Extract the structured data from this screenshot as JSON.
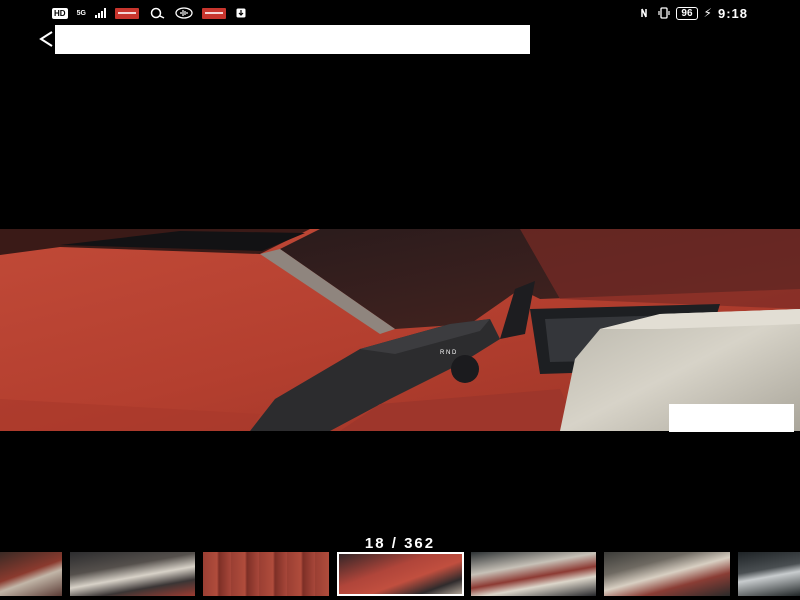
{
  "status_bar": {
    "hd": "HD",
    "network": "5G",
    "battery": "96",
    "time": "9:18",
    "icons": [
      "hd-icon",
      "signal-icon",
      "app-notification-icon",
      "message-icon",
      "radio-icon",
      "app-notification-icon",
      "download-icon",
      "nfc-icon",
      "vibrate-icon",
      "battery-icon",
      "charging-icon"
    ]
  },
  "header": {
    "back_icon": "back-arrow-icon",
    "title": ""
  },
  "viewer": {
    "counter": "18 / 362",
    "current_index": 18,
    "total": 362,
    "selected_thumbnail": 3
  },
  "thumbnails": [
    {
      "name": "thumbnail-16"
    },
    {
      "name": "thumbnail-17"
    },
    {
      "name": "thumbnail-18"
    },
    {
      "name": "thumbnail-19"
    },
    {
      "name": "thumbnail-20"
    },
    {
      "name": "thumbnail-21"
    },
    {
      "name": "thumbnail-22"
    }
  ],
  "colors": {
    "background": "#000000",
    "interior_red": "#b6402f",
    "accent_white": "#ffffff"
  }
}
